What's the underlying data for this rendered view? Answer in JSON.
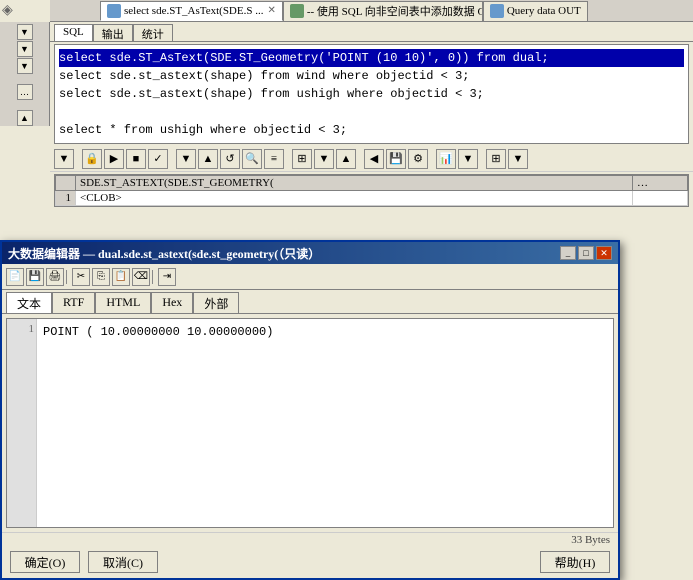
{
  "tabs": [
    {
      "id": "tab1",
      "label": "select sde.ST_AsText(SDE.S ...",
      "active": true,
      "iconColor": "blue"
    },
    {
      "id": "tab2",
      "label": "-- 使用 SQL 向非空间表中添加数据 CREAT ...",
      "active": false,
      "iconColor": "green"
    },
    {
      "id": "tab3",
      "label": "Query data OUT",
      "active": false,
      "iconColor": "blue"
    }
  ],
  "subtabs": [
    "SQL",
    "输出",
    "统计"
  ],
  "active_subtab": "SQL",
  "sql_lines": [
    {
      "text": "select sde.ST_AsText(SDE.ST_Geometry('POINT (10 10)', 0)) from dual;",
      "highlight": true
    },
    {
      "text": "select sde.st_astext(shape) from wind where objectid < 3;",
      "highlight": false
    },
    {
      "text": "select sde.st_astext(shape) from ushigh where objectid < 3;",
      "highlight": false
    },
    {
      "text": "",
      "highlight": false
    },
    {
      "text": "select * from ushigh where objectid < 3;",
      "highlight": false
    }
  ],
  "results": {
    "columns": [
      "SDE.ST_ASTEXT(SDE.ST_GEOMETRY("
    ],
    "rows": [
      [
        "1",
        "<CLOB>"
      ]
    ]
  },
  "modal": {
    "title": "大数据编辑器 — dual.sde.st_astext(sde.st_geometry(（只读）",
    "tabs": [
      "文本",
      "RTF",
      "HTML",
      "Hex",
      "外部"
    ],
    "active_tab": "文本",
    "content_line": "POINT   ( 10.00000000 10.00000000)",
    "line_number": "1",
    "status": "33 Bytes",
    "toolbar_icons": [
      "save",
      "print",
      "cut",
      "copy",
      "paste",
      "clear",
      "indent"
    ],
    "footer_buttons": {
      "ok": "确定(O)",
      "cancel": "取消(C)",
      "help": "帮助(H)"
    }
  },
  "pin_icon": "◈"
}
